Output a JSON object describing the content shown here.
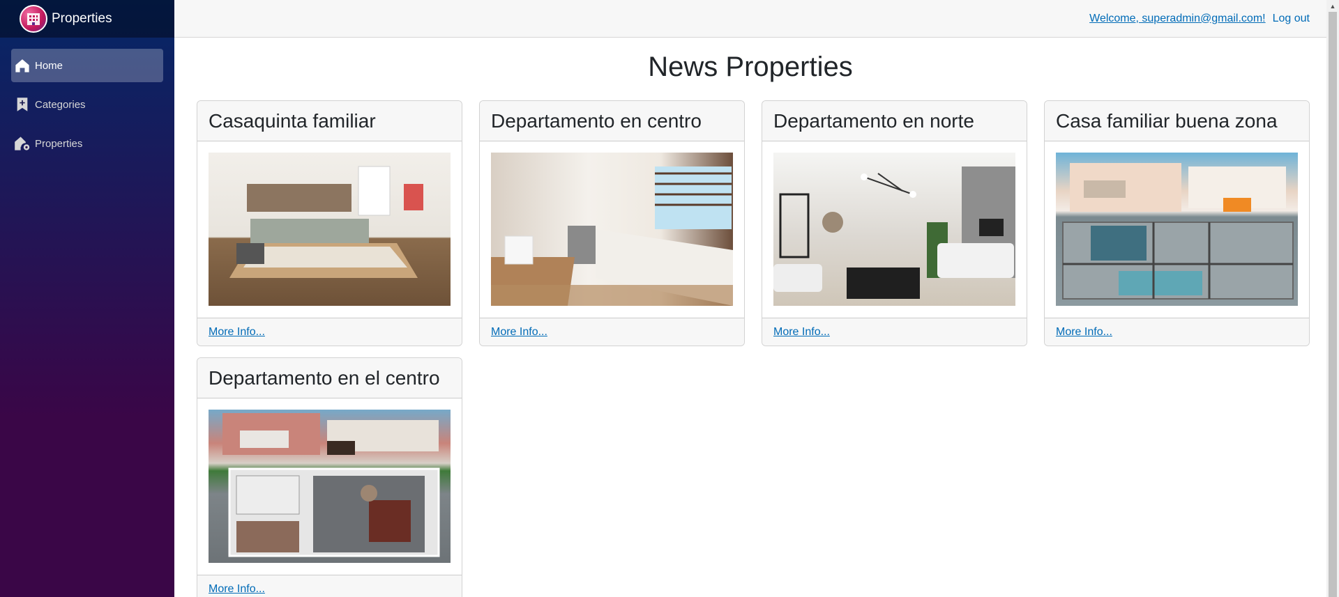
{
  "brand": {
    "title": "Properties",
    "logo_icon": "building-logo-icon"
  },
  "sidebar": {
    "items": [
      {
        "label": "Home",
        "icon": "home-icon",
        "active": true
      },
      {
        "label": "Categories",
        "icon": "bookmark-plus-icon",
        "active": false
      },
      {
        "label": "Properties",
        "icon": "house-gear-icon",
        "active": false
      }
    ]
  },
  "topbar": {
    "welcome": "Welcome, superadmin@gmail.com!",
    "logout": "Log out"
  },
  "main": {
    "title": "News Properties",
    "cards": [
      {
        "title": "Casaquinta familiar",
        "link": "More Info...",
        "image": "bedroom"
      },
      {
        "title": "Departamento en centro",
        "link": "More Info...",
        "image": "kitchen"
      },
      {
        "title": "Departamento en norte",
        "link": "More Info...",
        "image": "living room"
      },
      {
        "title": "Casa familiar buena zona",
        "link": "More Info...",
        "image": "house floor plan render"
      },
      {
        "title": "Departamento en el centro",
        "link": "More Info...",
        "image": "house floor plan render"
      }
    ]
  },
  "colors": {
    "sidebar_top": "#052767",
    "sidebar_bottom": "#3a0647",
    "link": "#006bb7",
    "topbar_bg": "#f7f7f7"
  }
}
